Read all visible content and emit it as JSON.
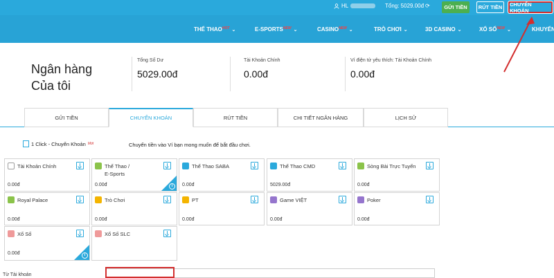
{
  "topbar": {
    "user_prefix": "HL",
    "balance_label": "Tổng: 5029.00đ",
    "deposit_label": "GỬI TIỀN",
    "withdraw_label": "RÚT TIỀN",
    "transfer_label": "CHUYỂN KHOẢN"
  },
  "nav": {
    "items": [
      {
        "label": "THỂ THAO",
        "badge": "HOT"
      },
      {
        "label": "E-SPORTS",
        "badge": "NEW"
      },
      {
        "label": "CASINO",
        "badge": "NEW"
      },
      {
        "label": "TRÒ CHƠI",
        "badge": ""
      },
      {
        "label": "3D CASINO",
        "badge": ""
      },
      {
        "label": "XỔ SỐ",
        "badge": "NEW"
      },
      {
        "label": "KHUYẾN",
        "badge": ""
      }
    ]
  },
  "bank": {
    "title_line1": "Ngân hàng",
    "title_line2": "Của tôi",
    "stats": [
      {
        "label": "Tổng Số Dư",
        "value": "5029.00đ"
      },
      {
        "label": "Tài Khoản Chính",
        "value": "0.00đ"
      },
      {
        "label": "Ví điện tử yêu thích: Tài Khoản Chính",
        "value": "0.00đ"
      }
    ]
  },
  "tabs": [
    {
      "label": "GỬI TIỀN",
      "active": false
    },
    {
      "label": "CHUYỂN KHOẢN",
      "active": true
    },
    {
      "label": "RÚT TIỀN",
      "active": false
    },
    {
      "label": "CHI TIẾT NGÂN HÀNG",
      "active": false
    },
    {
      "label": "LỊCH SỬ",
      "active": false
    }
  ],
  "transfer": {
    "oneclick_label": "1 Click - Chuyển Khoản",
    "oneclick_badge": "Mới",
    "instruction": "Chuyển tiền vào Ví bạn mong muốn để bắt đầu chơi."
  },
  "wallets": [
    {
      "name": "Tài Khoản Chính",
      "name2": "",
      "amount": "0.00đ",
      "color": "#9e9e9e",
      "info": false
    },
    {
      "name": "Thể Thao /",
      "name2": "E-Sports",
      "amount": "0.00đ",
      "color": "#8bc34a",
      "info": true
    },
    {
      "name": "Thể Thao SABA",
      "name2": "",
      "amount": "0.00đ",
      "color": "#2aa9dc",
      "info": false
    },
    {
      "name": "Thể Thao CMD",
      "name2": "",
      "amount": "5029.00đ",
      "color": "#2aa9dc",
      "info": false
    },
    {
      "name": "Sòng Bài Trực Tuyến",
      "name2": "",
      "amount": "0.00đ",
      "color": "#8bc34a",
      "info": false
    },
    {
      "name": "Royal Palace",
      "name2": "",
      "amount": "0.00đ",
      "color": "#8bc34a",
      "info": false
    },
    {
      "name": "Trò Chơi",
      "name2": "",
      "amount": "0.00đ",
      "color": "#f4b400",
      "info": false
    },
    {
      "name": "PT",
      "name2": "",
      "amount": "0.00đ",
      "color": "#f4b400",
      "info": false
    },
    {
      "name": "Game VIỆT",
      "name2": "",
      "amount": "0.00đ",
      "color": "#9575cd",
      "info": false
    },
    {
      "name": "Poker",
      "name2": "",
      "amount": "0.00đ",
      "color": "#9575cd",
      "info": false
    },
    {
      "name": "Xổ Số",
      "name2": "",
      "amount": "0.00đ",
      "color": "#ef9a9a",
      "info": true
    },
    {
      "name": "Xổ Số SLC",
      "name2": "",
      "amount": "",
      "color": "#ef9a9a",
      "info": false
    }
  ],
  "footer": {
    "from_label": "Từ Tài khoản"
  },
  "colors": {
    "primary": "#2aa9dc",
    "deposit": "#4caf50",
    "highlight": "#d32f2f"
  }
}
